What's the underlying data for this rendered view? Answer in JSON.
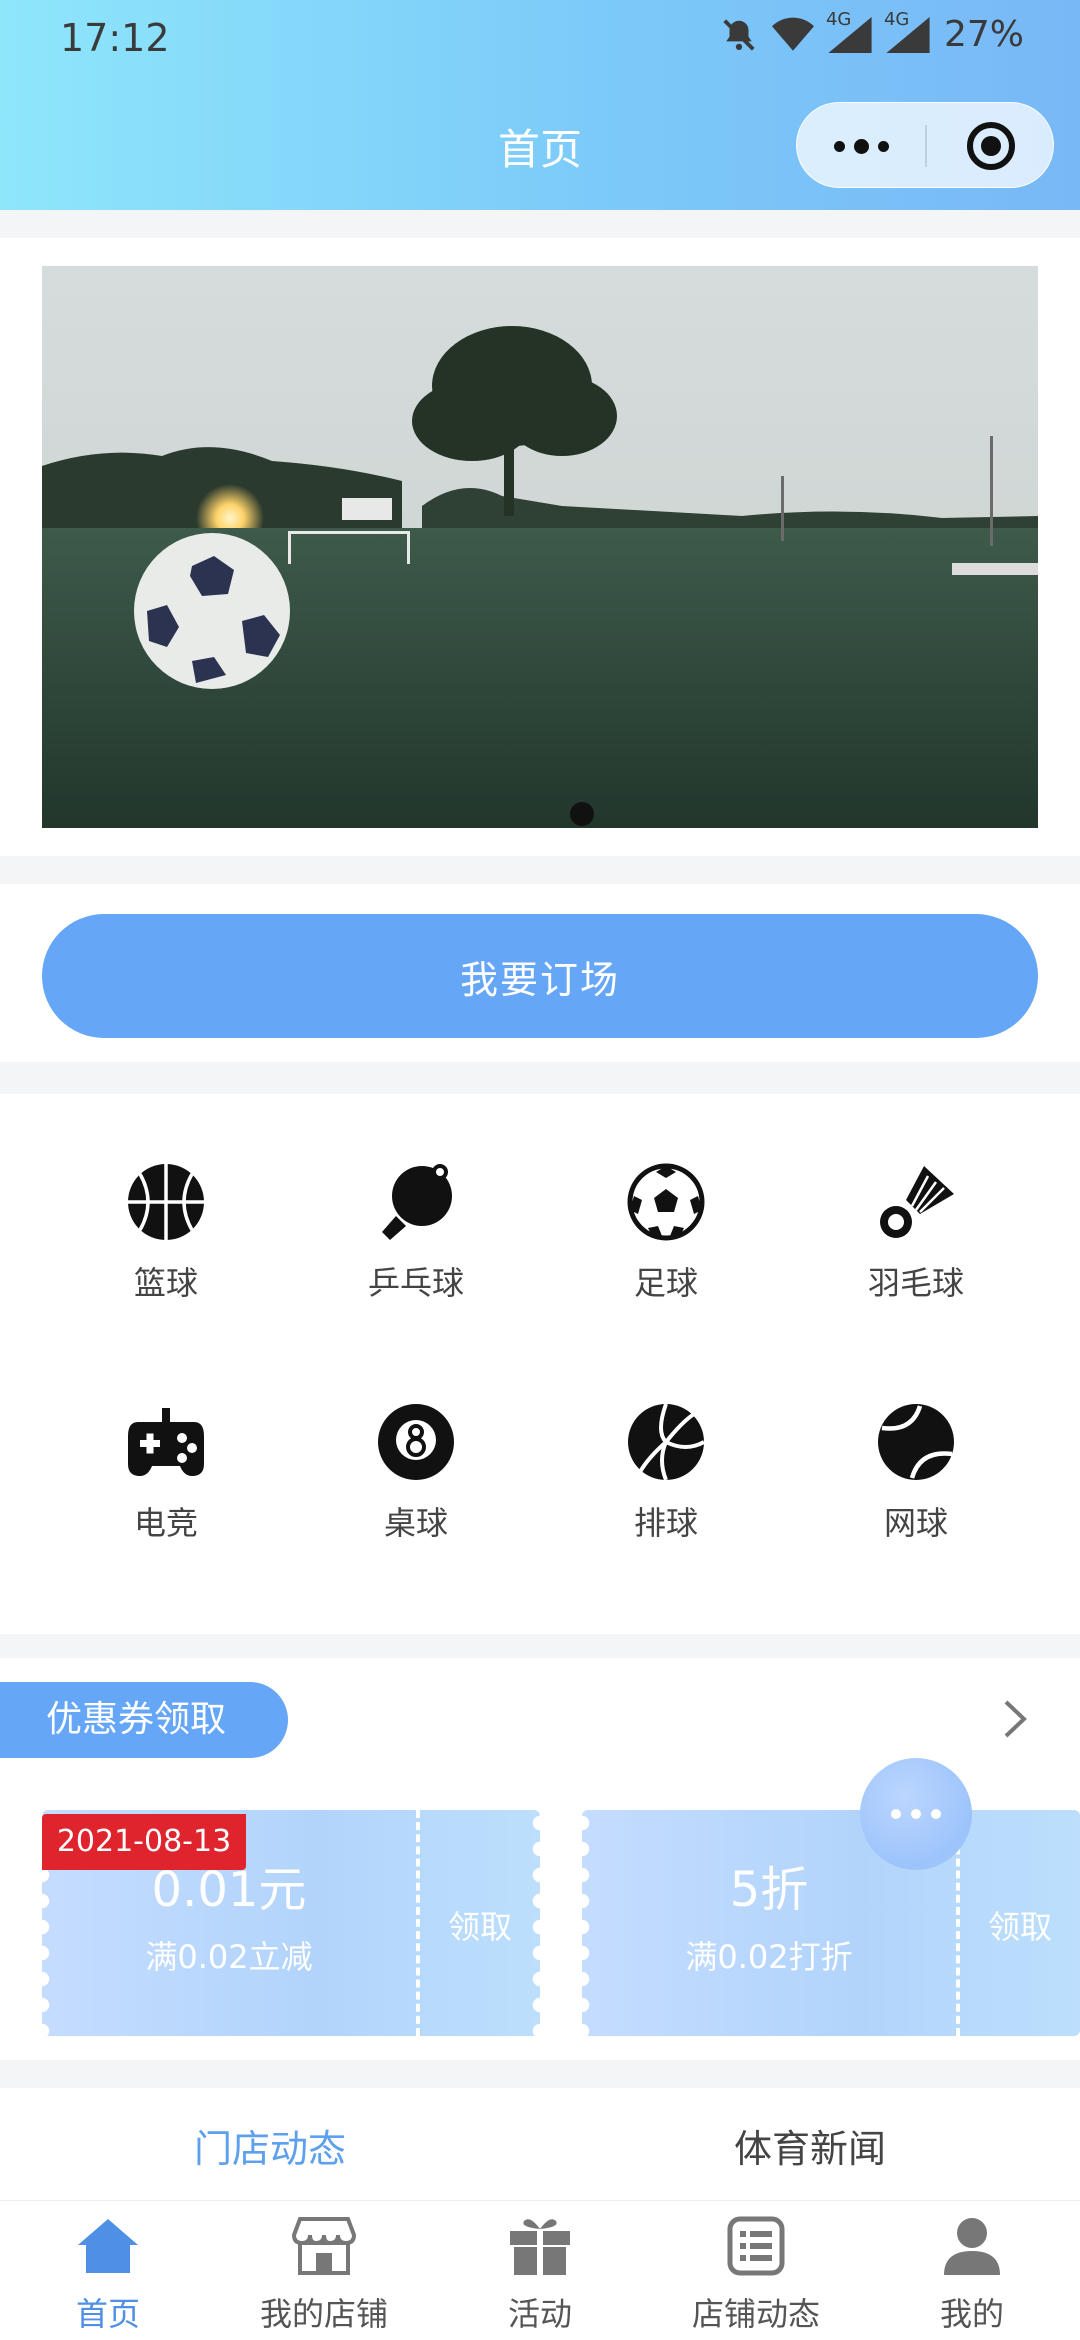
{
  "status_bar": {
    "time": "17:12",
    "network_1": "4G",
    "network_2": "4G",
    "battery": "27%"
  },
  "nav": {
    "title": "首页"
  },
  "banner": {
    "slide_count": 1,
    "active_slide": 1
  },
  "booking": {
    "button_label": "我要订场"
  },
  "sports": [
    {
      "label": "篮球",
      "icon": "basketball-icon"
    },
    {
      "label": "乒乓球",
      "icon": "ping-pong-icon"
    },
    {
      "label": "足球",
      "icon": "soccer-ball-icon"
    },
    {
      "label": "羽毛球",
      "icon": "shuttlecock-icon"
    },
    {
      "label": "电竞",
      "icon": "gamepad-icon"
    },
    {
      "label": "桌球",
      "icon": "eight-ball-icon"
    },
    {
      "label": "排球",
      "icon": "volleyball-icon"
    },
    {
      "label": "网球",
      "icon": "tennis-ball-icon"
    }
  ],
  "coupons": {
    "section_title": "优惠券领取",
    "items": [
      {
        "date": "2021-08-13",
        "amount": "0.01元",
        "condition": "满0.02立减",
        "claim_label": "领取"
      },
      {
        "amount": "5折",
        "condition": "满0.02打折",
        "claim_label": "领取"
      }
    ]
  },
  "news_tabs": [
    {
      "label": "门店动态",
      "active": true
    },
    {
      "label": "体育新闻",
      "active": false
    }
  ],
  "tabbar": [
    {
      "label": "首页",
      "icon": "home-icon",
      "active": true
    },
    {
      "label": "我的店铺",
      "icon": "store-icon",
      "active": false
    },
    {
      "label": "活动",
      "icon": "gift-icon",
      "active": false
    },
    {
      "label": "店铺动态",
      "icon": "list-icon",
      "active": false
    },
    {
      "label": "我的",
      "icon": "user-icon",
      "active": false
    }
  ],
  "colors": {
    "accent": "#66a6f7",
    "header_start": "#8ee6fb",
    "header_end": "#78b8f6",
    "date_tag": "#e0242e"
  }
}
